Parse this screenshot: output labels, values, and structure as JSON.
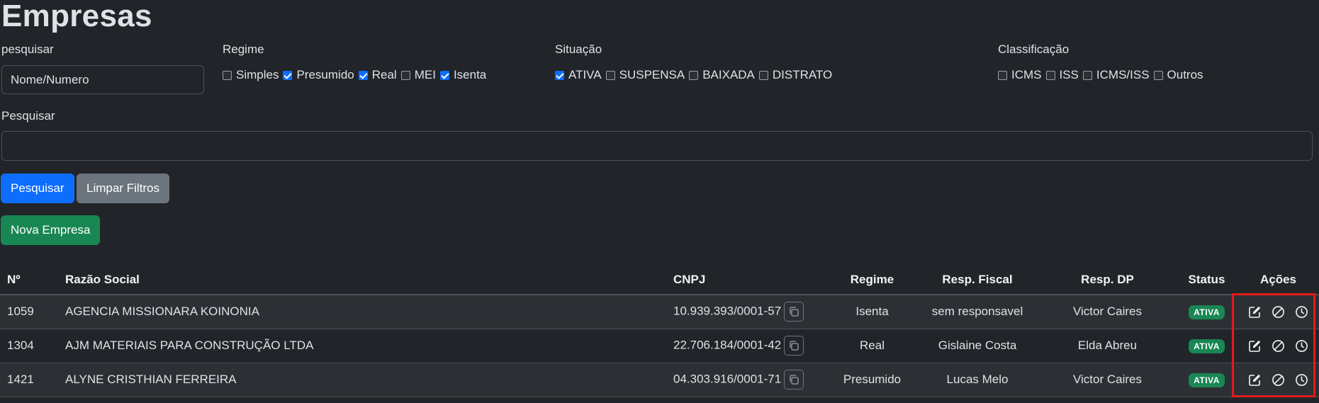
{
  "page": {
    "title": "Empresas"
  },
  "filters": {
    "search_label": "pesquisar",
    "search_placeholder": "Nome/Numero",
    "regime": {
      "label": "Regime",
      "options": [
        {
          "label": "Simples",
          "checked": false
        },
        {
          "label": "Presumido",
          "checked": true
        },
        {
          "label": "Real",
          "checked": true
        },
        {
          "label": "MEI",
          "checked": false
        },
        {
          "label": "Isenta",
          "checked": true
        }
      ]
    },
    "situacao": {
      "label": "Situação",
      "options": [
        {
          "label": "ATIVA",
          "checked": true
        },
        {
          "label": "SUSPENSA",
          "checked": false
        },
        {
          "label": "BAIXADA",
          "checked": false
        },
        {
          "label": "DISTRATO",
          "checked": false
        }
      ]
    },
    "classificacao": {
      "label": "Classificação",
      "options": [
        {
          "label": "ICMS",
          "checked": false
        },
        {
          "label": "ISS",
          "checked": false
        },
        {
          "label": "ICMS/ISS",
          "checked": false
        },
        {
          "label": "Outros",
          "checked": false
        }
      ]
    },
    "pesquisar_label": "Pesquisar",
    "pesquisar_value": ""
  },
  "buttons": {
    "search": "Pesquisar",
    "clear": "Limpar Filtros",
    "new": "Nova Empresa"
  },
  "table": {
    "headers": {
      "num": "Nº",
      "razao": "Razão Social",
      "cnpj": "CNPJ",
      "regime": "Regime",
      "resp_fiscal": "Resp. Fiscal",
      "resp_dp": "Resp. DP",
      "status": "Status",
      "acoes": "Ações"
    },
    "rows": [
      {
        "num": "1059",
        "razao": "AGENCIA MISSIONARA KOINONIA",
        "cnpj": "10.939.393/0001-57",
        "regime": "Isenta",
        "resp_fiscal": "sem responsavel",
        "resp_dp": "Victor Caires",
        "status": "ATIVA"
      },
      {
        "num": "1304",
        "razao": "AJM MATERIAIS PARA CONSTRUÇÃO LTDA",
        "cnpj": "22.706.184/0001-42",
        "regime": "Real",
        "resp_fiscal": "Gislaine Costa",
        "resp_dp": "Elda Abreu",
        "status": "ATIVA"
      },
      {
        "num": "1421",
        "razao": "ALYNE CRISTHIAN FERREIRA",
        "cnpj": "04.303.916/0001-71",
        "regime": "Presumido",
        "resp_fiscal": "Lucas Melo",
        "resp_dp": "Victor Caires",
        "status": "ATIVA"
      }
    ]
  },
  "colors": {
    "background": "#212529",
    "primary": "#0d6efd",
    "secondary": "#6c757d",
    "success": "#198754",
    "highlight": "#e31b1b"
  },
  "icons": [
    "edit-icon",
    "block-icon",
    "history-icon",
    "copy-icon"
  ]
}
